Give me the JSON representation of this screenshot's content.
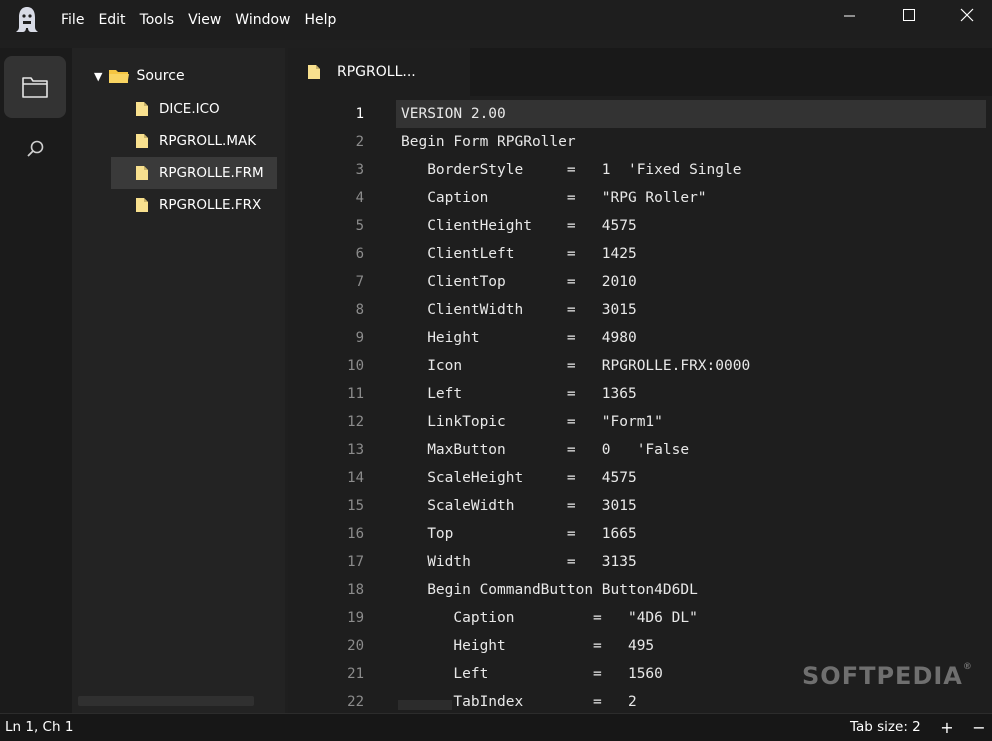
{
  "menu": [
    "File",
    "Edit",
    "Tools",
    "View",
    "Window",
    "Help"
  ],
  "sidebar": {
    "root": "Source",
    "files": [
      "DICE.ICO",
      "RPGROLL.MAK",
      "RPGROLLE.FRM",
      "RPGROLLE.FRX"
    ],
    "selected_index": 2
  },
  "editor": {
    "tab_label": "RPGROLL...",
    "current_line": 1,
    "lines": [
      "VERSION 2.00",
      "Begin Form RPGRoller",
      "   BorderStyle     =   1  'Fixed Single",
      "   Caption         =   \"RPG Roller\"",
      "   ClientHeight    =   4575",
      "   ClientLeft      =   1425",
      "   ClientTop       =   2010",
      "   ClientWidth     =   3015",
      "   Height          =   4980",
      "   Icon            =   RPGROLLE.FRX:0000",
      "   Left            =   1365",
      "   LinkTopic       =   \"Form1\"",
      "   MaxButton       =   0   'False",
      "   ScaleHeight     =   4575",
      "   ScaleWidth      =   3015",
      "   Top             =   1665",
      "   Width           =   3135",
      "   Begin CommandButton Button4D6DL",
      "      Caption         =   \"4D6 DL\"",
      "      Height          =   495",
      "      Left            =   1560",
      "      TabIndex        =   2"
    ]
  },
  "status": {
    "position": "Ln 1, Ch 1",
    "tab_size": "Tab size: 2",
    "plus": "+",
    "minus": "−"
  },
  "watermark": "SOFTPEDIA",
  "watermark_mark": "®",
  "colors": {
    "background": "#1f1f1f",
    "selection": "#3a3a3a",
    "file_icon": "#f8e08e",
    "folder_icon": "#f5c542"
  }
}
